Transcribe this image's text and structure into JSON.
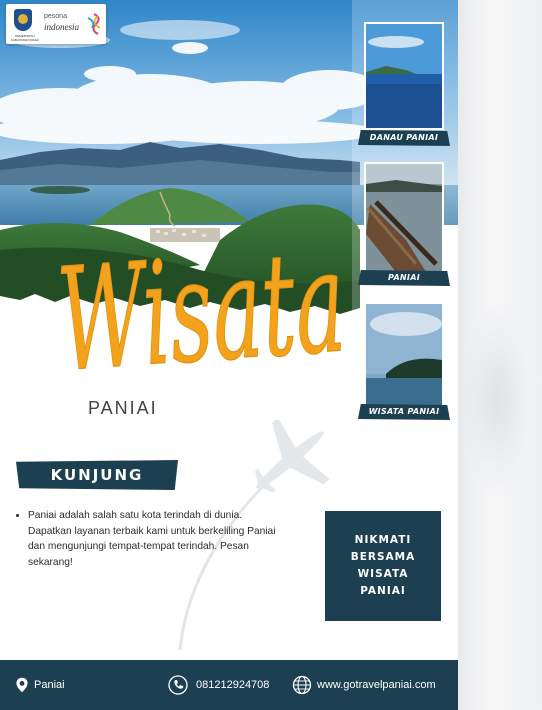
{
  "logo": {
    "line1": "pesona",
    "line2": "indonesia",
    "gov_text": "PEMERINTAH KABUPATEN PANIAI",
    "seal_icon": "regency-seal-icon",
    "swirl_icon": "pesona-swirl-icon"
  },
  "headline": {
    "script": "Wisata",
    "subtitle": "PANIAI",
    "color": "#f2a21b"
  },
  "cards": [
    {
      "label": "DANAU PANIAI"
    },
    {
      "label": "PANIAI"
    },
    {
      "label": "WISATA PANIAI"
    }
  ],
  "kunjung": {
    "label": "KUNJUNG",
    "description": "Paniai adalah salah satu kota terindah di dunia. Dapatkan layanan terbaik kami untuk berkeliling Paniai dan mengunjungi tempat-tempat terindah. Pesan sekarang!"
  },
  "nikmati": {
    "line1": "NIKMATI",
    "line2": "BERSAMA WISATA",
    "line3": "PANIAI"
  },
  "footer": {
    "location": "Paniai",
    "phone": "081212924708",
    "website": "www.gotravelpaniai.com",
    "location_icon": "map-pin-icon",
    "phone_icon": "phone-icon",
    "web_icon": "globe-icon"
  },
  "colors": {
    "navy": "#1d3f52",
    "accent": "#f2a21b"
  }
}
